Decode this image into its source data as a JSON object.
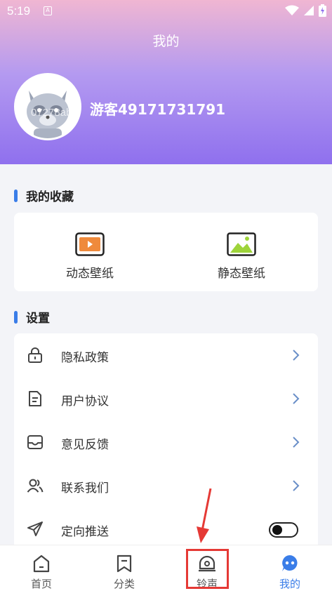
{
  "status_bar": {
    "time": "5:19",
    "indicator": "A"
  },
  "header": {
    "title": "我的"
  },
  "profile": {
    "avatar_watermark": "07278ab0",
    "username": "游客49171731791"
  },
  "favorites": {
    "title": "我的收藏",
    "items": [
      {
        "label": "动态壁纸",
        "icon": "video-wallpaper-icon"
      },
      {
        "label": "静态壁纸",
        "icon": "image-wallpaper-icon"
      }
    ]
  },
  "settings": {
    "title": "设置",
    "items": [
      {
        "label": "隐私政策",
        "icon": "lock-icon"
      },
      {
        "label": "用户协议",
        "icon": "document-icon"
      },
      {
        "label": "意见反馈",
        "icon": "inbox-icon"
      },
      {
        "label": "联系我们",
        "icon": "contacts-icon"
      },
      {
        "label": "定向推送",
        "icon": "send-icon",
        "toggle": "off"
      }
    ]
  },
  "tabbar": {
    "items": [
      {
        "label": "首页",
        "icon": "home-icon"
      },
      {
        "label": "分类",
        "icon": "bookmark-icon"
      },
      {
        "label": "铃声",
        "icon": "bell-icon"
      },
      {
        "label": "我的",
        "icon": "profile-chat-icon",
        "active": true
      }
    ]
  },
  "colors": {
    "accent": "#3a7de8",
    "highlight": "#e53935",
    "header_start": "#f0b6d2",
    "header_end": "#8f70ee"
  }
}
